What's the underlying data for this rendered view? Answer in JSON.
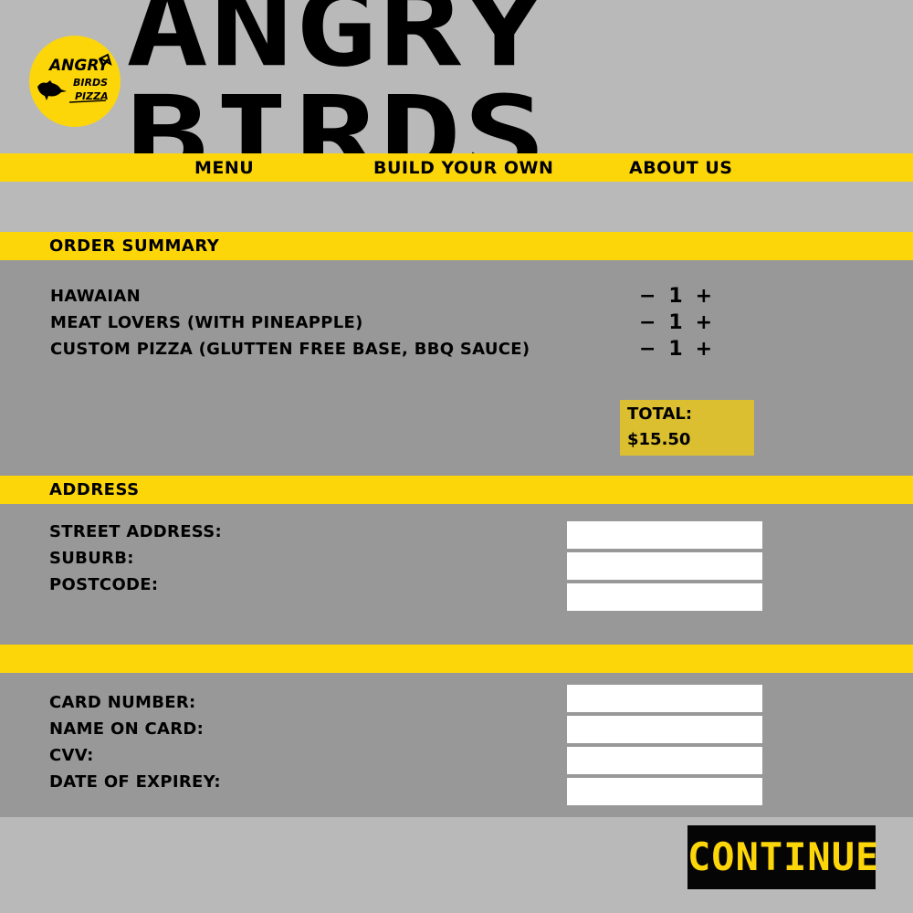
{
  "brand": {
    "title": "ANGRY BIRDS",
    "logo_line1": "ANGRY",
    "logo_line2": "BIRDS",
    "logo_line3": "PIZZA"
  },
  "nav": [
    {
      "label": "MENU"
    },
    {
      "label": "BUILD YOUR OWN"
    },
    {
      "label": "ABOUT US"
    }
  ],
  "order": {
    "title": "ORDER SUMMARY",
    "items": [
      {
        "name": "HAWAIAN",
        "qty": "1"
      },
      {
        "name": "MEAT LOVERS (WITH PINEAPPLE)",
        "qty": "1"
      },
      {
        "name": "CUSTOM PIZZA (GLUTTEN FREE BASE, BBQ SAUCE)",
        "qty": "1"
      }
    ],
    "total_label": "TOTAL:",
    "total_value": "$15.50"
  },
  "address": {
    "title": "ADDRESS",
    "fields": [
      {
        "label": "STREET ADDRESS:",
        "value": ""
      },
      {
        "label": "SUBURB:",
        "value": ""
      },
      {
        "label": "POSTCODE:",
        "value": ""
      }
    ]
  },
  "payment": {
    "fields": [
      {
        "label": "CARD NUMBER:",
        "value": ""
      },
      {
        "label": "NAME ON CARD:",
        "value": ""
      },
      {
        "label": "CVV:",
        "value": ""
      },
      {
        "label": "DATE OF EXPIREY:",
        "value": ""
      }
    ]
  },
  "continue_label": "CONTINUE",
  "colors": {
    "accent_yellow": "#fdd60a",
    "total_box": "#dbbf31",
    "panel_gray": "#989898",
    "background": "#b9b9b9"
  }
}
